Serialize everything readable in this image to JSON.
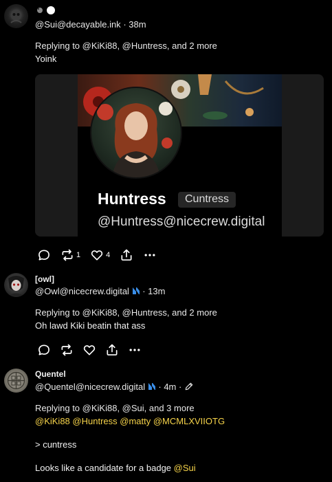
{
  "posts": [
    {
      "display_name": "",
      "handle": "@Sui@decayable.ink",
      "time": "38m",
      "reply_prefix": "Replying to",
      "reply_targets": "@KiKi88, @Huntress, and 2 more",
      "body": "Yoink",
      "card": {
        "name": "Huntress",
        "badge": "Cuntress",
        "handle": "@Huntress@nicecrew.digital"
      },
      "repost_count": "1",
      "like_count": "4"
    },
    {
      "display_name": "[owl]",
      "handle": "@Owl@nicecrew.digital",
      "time": "13m",
      "reply_prefix": "Replying to",
      "reply_targets": "@KiKi88, @Huntress, and 2 more",
      "body": "Oh lawd Kiki beatin that ass"
    },
    {
      "display_name": "Quentel",
      "handle": "@Quentel@nicecrew.digital",
      "time": "4m",
      "reply_prefix": "Replying to",
      "reply_targets": "@KiKi88, @Sui, and 3 more",
      "mentions": [
        "@KiKi88",
        "@Huntress",
        "@matty",
        "@MCMLXVIIOTG"
      ],
      "quote": "> cuntress",
      "body_text": "Looks like a candidate for a badge",
      "body_mention": "@Sui"
    }
  ],
  "colors": {
    "mention": "#f7d44a",
    "background": "#000000"
  },
  "icons": [
    "reply-icon",
    "repost-icon",
    "like-icon",
    "share-icon",
    "more-icon",
    "edit-icon",
    "instance-badge-icon"
  ]
}
